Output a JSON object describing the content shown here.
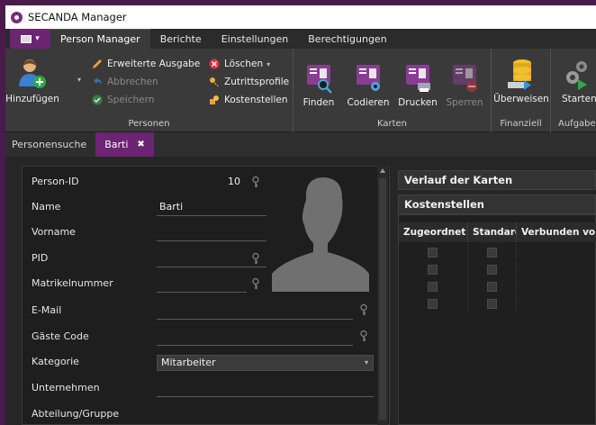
{
  "window": {
    "title": "SECANDA Manager"
  },
  "ribbon_tabs": [
    "Person Manager",
    "Berichte",
    "Einstellungen",
    "Berechtigungen"
  ],
  "ribbon": {
    "personen": {
      "label": "Personen",
      "add": "Hinzufügen",
      "extended_output": "Erweiterte Ausgabe",
      "cancel": "Abbrechen",
      "save": "Speichern",
      "delete": "Löschen",
      "access_profiles": "Zutrittsprofile",
      "cost_centers": "Kostenstellen"
    },
    "karten": {
      "label": "Karten",
      "find": "Finden",
      "encode": "Codieren",
      "print": "Drucken",
      "lock": "Sperren"
    },
    "finanziell": {
      "label": "Finanziell",
      "transfer": "Überweisen"
    },
    "aufgaben": {
      "label": "Aufgaben",
      "start": "Starten"
    }
  },
  "doc_tabs": [
    "Personensuche",
    "Barti"
  ],
  "form": {
    "person_id": {
      "label": "Person-ID",
      "value": "10"
    },
    "name": {
      "label": "Name",
      "value": "Barti"
    },
    "vorname": {
      "label": "Vorname",
      "value": ""
    },
    "pid": {
      "label": "PID",
      "value": ""
    },
    "matrikel": {
      "label": "Matrikelnummer",
      "value": ""
    },
    "email": {
      "label": "E-Mail",
      "value": ""
    },
    "guest_code": {
      "label": "Gäste Code",
      "value": ""
    },
    "kategorie": {
      "label": "Kategorie",
      "value": "Mitarbeiter"
    },
    "unternehmen": {
      "label": "Unternehmen",
      "value": ""
    },
    "abteilung": {
      "label": "Abteilung/Gruppe",
      "value": ""
    }
  },
  "right": {
    "history_header": "Verlauf der Karten",
    "cost_header": "Kostenstellen",
    "columns": [
      "Zugeordnet",
      "Standard",
      "Verbunden vo"
    ],
    "rows": 4
  }
}
